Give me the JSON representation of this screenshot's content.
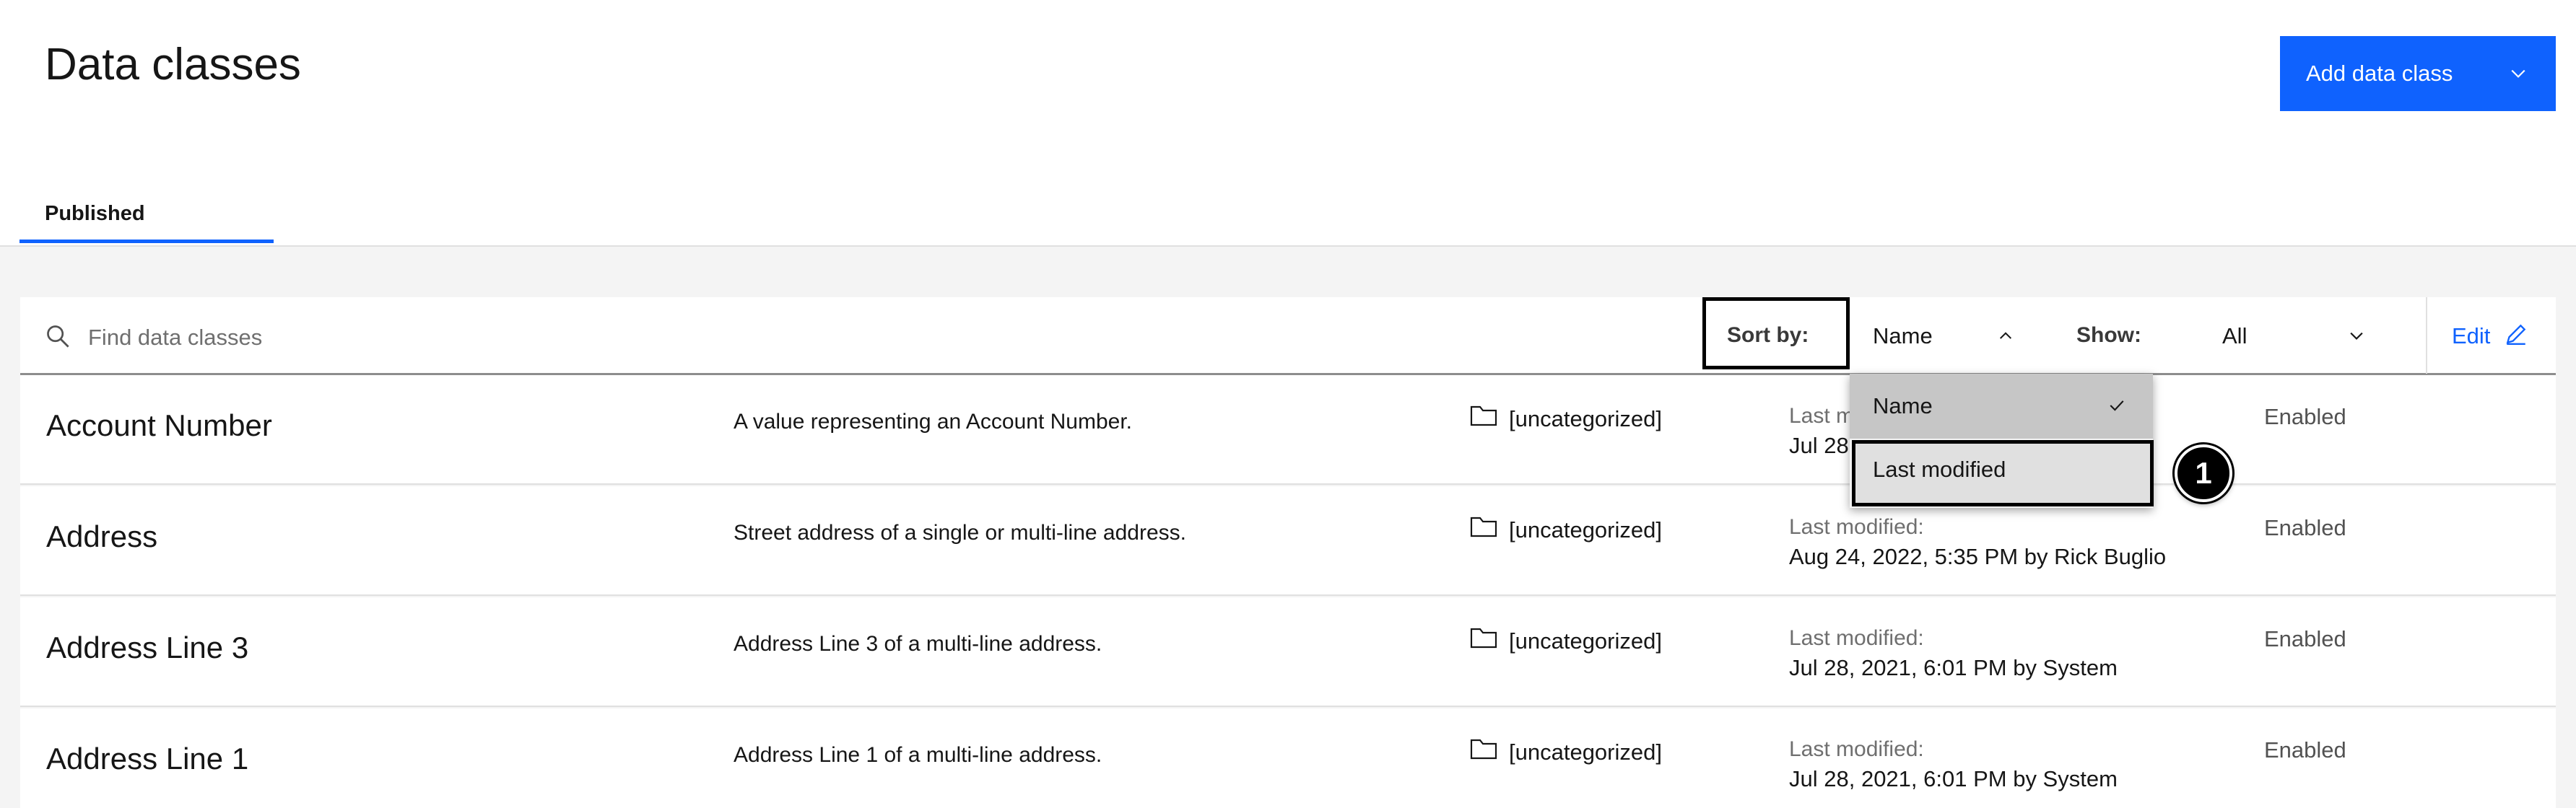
{
  "header": {
    "title": "Data classes",
    "add_button_label": "Add data class",
    "add_button_menu_icon": "chevron-down-icon"
  },
  "tabs": [
    {
      "label": "Published",
      "active": true
    }
  ],
  "toolbar": {
    "search_placeholder": "Find data classes",
    "sort_label": "Sort by:",
    "sort_value": "Name",
    "show_label": "Show:",
    "show_value": "All",
    "edit_label": "Edit"
  },
  "sort_menu": {
    "options": [
      {
        "label": "Name",
        "selected": true
      },
      {
        "label": "Last modified",
        "selected": false
      }
    ]
  },
  "callout": {
    "number": "1"
  },
  "rows": [
    {
      "name": "Account Number",
      "description": "A value representing an Account Number.",
      "category": "[uncategorized]",
      "modified_label": "Last modified:",
      "modified_value": "Jul 28",
      "status": "Enabled"
    },
    {
      "name": "Address",
      "description": "Street address of a single or multi-line address.",
      "category": "[uncategorized]",
      "modified_label": "Last modified:",
      "modified_value": "Aug 24, 2022, 5:35 PM by Rick Buglio",
      "status": "Enabled"
    },
    {
      "name": "Address Line 3",
      "description": "Address Line 3 of a multi-line address.",
      "category": "[uncategorized]",
      "modified_label": "Last modified:",
      "modified_value": "Jul 28, 2021, 6:01 PM by System",
      "status": "Enabled"
    },
    {
      "name": "Address Line 1",
      "description": "Address Line 1 of a multi-line address.",
      "category": "[uncategorized]",
      "modified_label": "Last modified:",
      "modified_value": "Jul 28, 2021, 6:01 PM by System",
      "status": "Enabled"
    }
  ],
  "colors": {
    "primary": "#0f62fe",
    "background": "#f4f4f4",
    "selected_option": "#c6c6c6"
  }
}
